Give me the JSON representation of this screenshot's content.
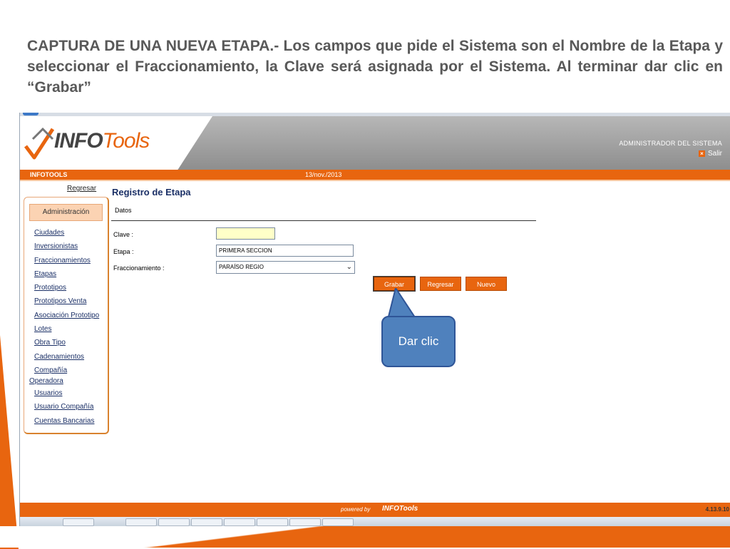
{
  "slide": {
    "title": "CAPTURA DE UNA NUEVA ETAPA.- Los campos que pide el Sistema son el Nombre de la Etapa y seleccionar el Fraccionamiento, la Clave será asignada por el Sistema. Al terminar dar clic en “Grabar”",
    "callout_text": "Dar clic",
    "accent_color": "#e8650f",
    "callout_color": "#4f81bd"
  },
  "header": {
    "logo_info": "INFO",
    "logo_tools": "Tools",
    "user_role": "ADMINISTRADOR DEL SISTEMA",
    "logout_label": "Salir",
    "logout_icon": "close-icon"
  },
  "infobar": {
    "app_label": "INFOTOOLS",
    "date": "13/nov./2013"
  },
  "sidebar": {
    "back_link": "Regresar",
    "section_title": "Administración",
    "items": [
      {
        "label": "Ciudades"
      },
      {
        "label": "Inversionistas"
      },
      {
        "label": "Fraccionamientos"
      },
      {
        "label": "Etapas"
      },
      {
        "label": "Prototipos"
      },
      {
        "label": "Prototipos Venta"
      },
      {
        "label": "Asociación Prototipo"
      },
      {
        "label": "Lotes"
      },
      {
        "label": "Obra Tipo"
      },
      {
        "label": "Cadenamientos"
      },
      {
        "label": "Compañía"
      },
      {
        "label": "Operadora"
      },
      {
        "label": "Usuarios"
      },
      {
        "label": "Usuario Compañía"
      },
      {
        "label": "Cuentas Bancarias"
      }
    ]
  },
  "form": {
    "title": "Registro de Etapa",
    "section": "Datos",
    "clave_label": "Clave :",
    "clave_value": "",
    "etapa_label": "Etapa :",
    "etapa_value": "PRIMERA SECCION",
    "fracc_label": "Fraccionamiento :",
    "fracc_value": "PARAÍSO REGIO",
    "buttons": {
      "save": "Grabar",
      "back": "Regresar",
      "new": "Nuevo"
    }
  },
  "footer": {
    "powered_by": "powered by",
    "brand": "INFOTools",
    "version": "4.13.9.10"
  }
}
